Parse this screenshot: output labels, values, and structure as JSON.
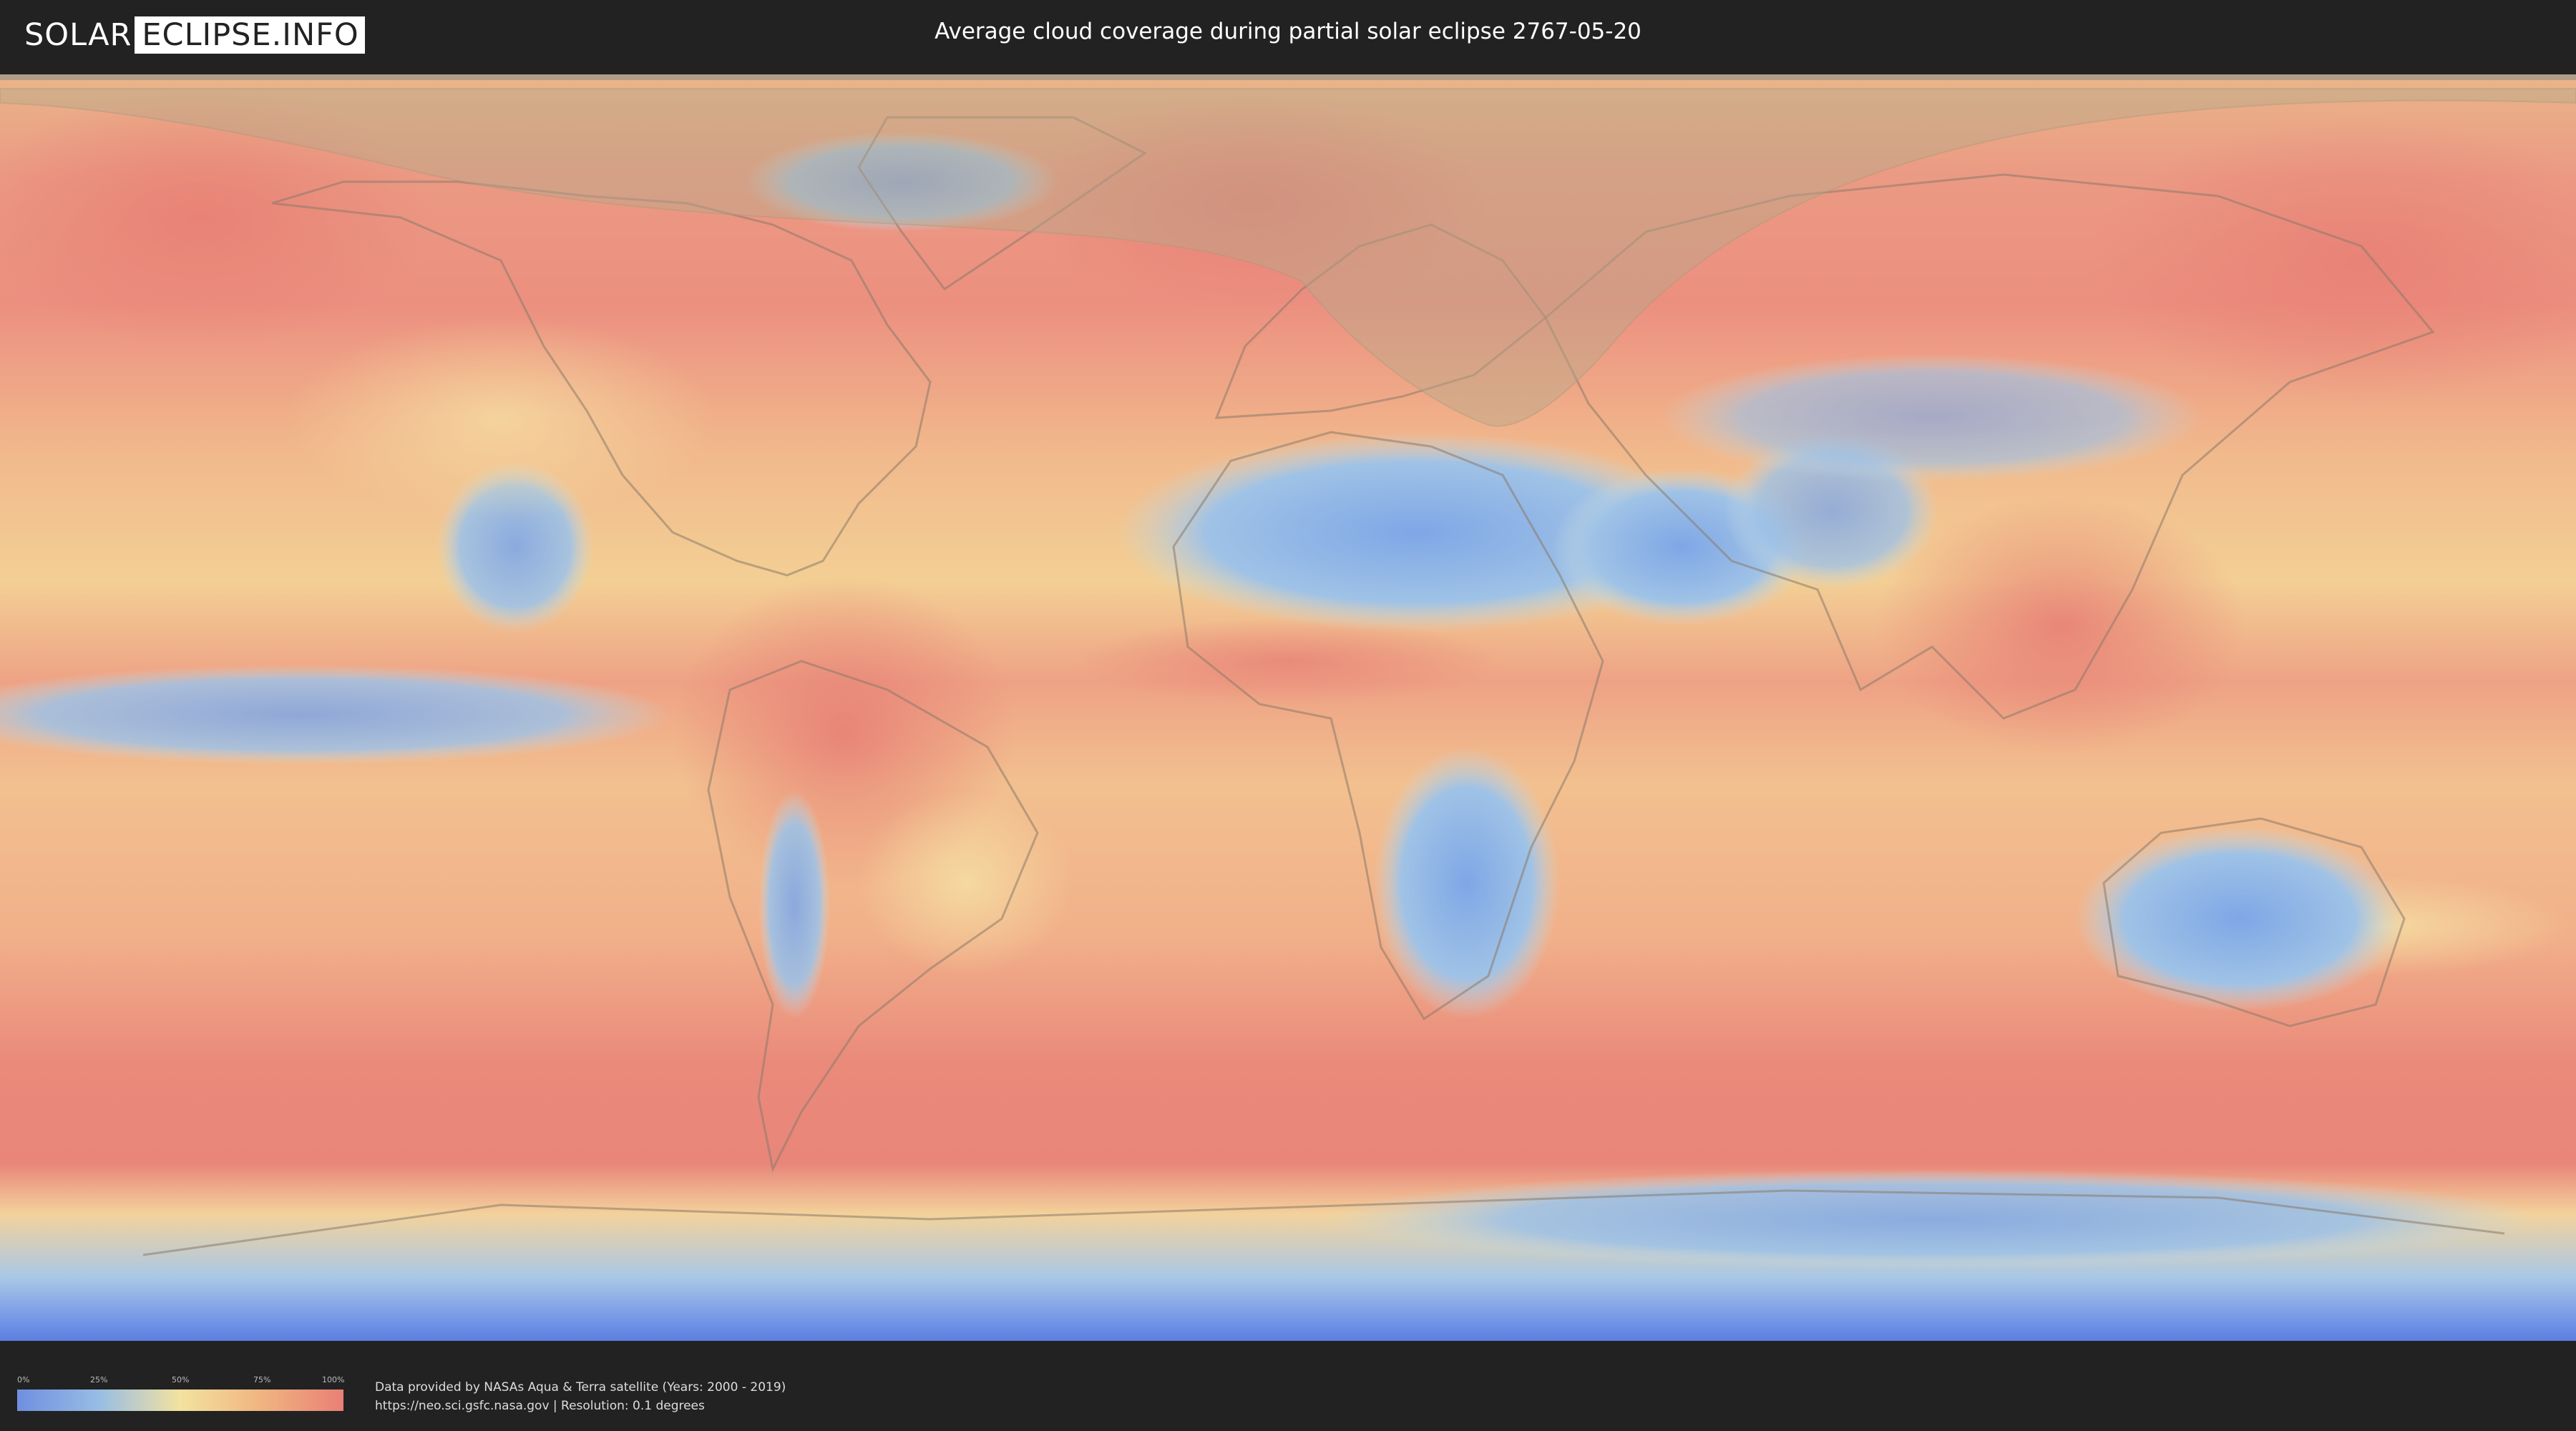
{
  "header": {
    "logo_left": "SOLAR",
    "logo_right": "ECLIPSE.INFO",
    "title": "Average cloud coverage during partial solar eclipse 2767-05-20"
  },
  "map": {
    "projection": "equirectangular world map",
    "layer": "average cloud coverage",
    "overlay": "partial solar eclipse visibility zone (northern high latitudes, North Atlantic, Greenland, Europe, Siberia)",
    "colors": {
      "low": "#6f8fe0",
      "mid_low": "#97bde4",
      "mid": "#f3e2a0",
      "mid_high": "#f0b480",
      "high": "#e97f76",
      "eclipse_shade": "#b9a98a"
    }
  },
  "legend": {
    "ticks": [
      "0%",
      "25%",
      "50%",
      "75%",
      "100%"
    ],
    "tick_fractions": [
      0,
      0.25,
      0.5,
      0.75,
      1
    ]
  },
  "credits": {
    "line1": "Data provided by NASAs Aqua & Terra satellite (Years: 2000 - 2019)",
    "line2": "https://neo.sci.gsfc.nasa.gov | Resolution: 0.1 degrees"
  }
}
